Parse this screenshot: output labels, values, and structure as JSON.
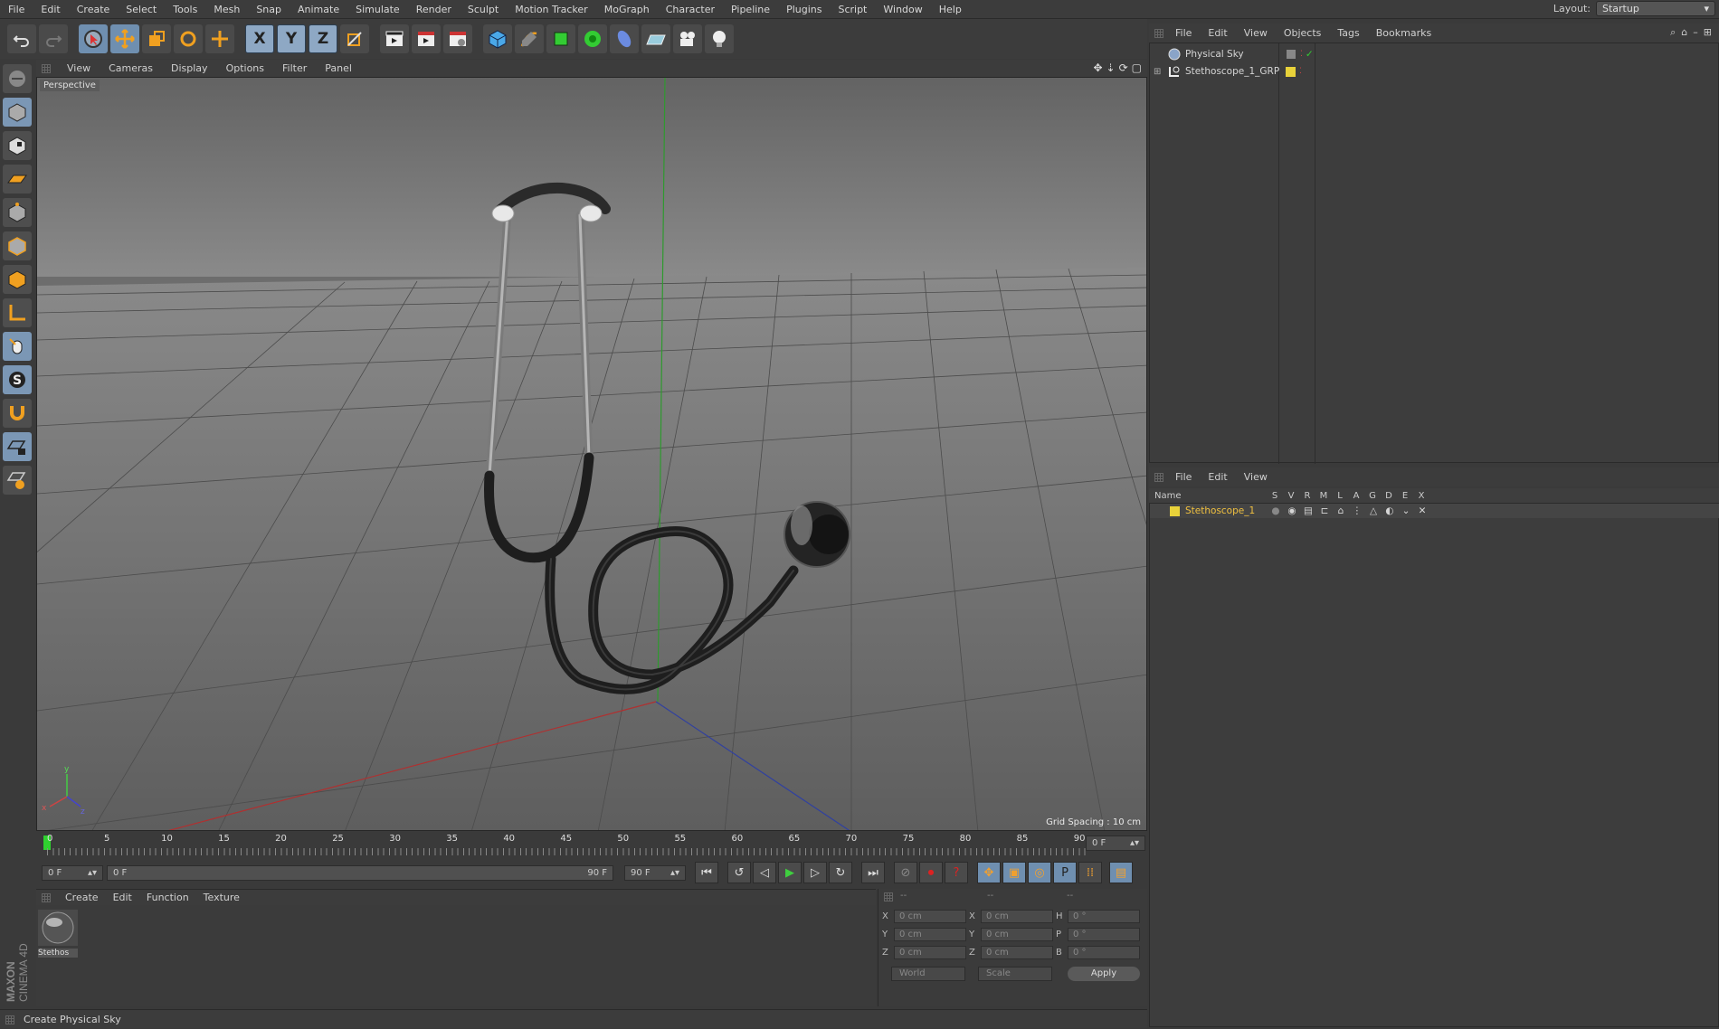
{
  "menubar": {
    "items": [
      "File",
      "Edit",
      "Create",
      "Select",
      "Tools",
      "Mesh",
      "Snap",
      "Animate",
      "Simulate",
      "Render",
      "Sculpt",
      "Motion Tracker",
      "MoGraph",
      "Character",
      "Pipeline",
      "Plugins",
      "Script",
      "Window",
      "Help"
    ],
    "layout_label": "Layout:",
    "layout_value": "Startup"
  },
  "toolbar": {
    "axis_x": "X",
    "axis_y": "Y",
    "axis_z": "Z"
  },
  "viewport": {
    "menu": [
      "View",
      "Cameras",
      "Display",
      "Options",
      "Filter",
      "Panel"
    ],
    "camera_label": "Perspective",
    "grid_spacing": "Grid Spacing : 10 cm"
  },
  "timeline": {
    "ticks": [
      "0",
      "5",
      "10",
      "15",
      "20",
      "25",
      "30",
      "35",
      "40",
      "45",
      "50",
      "55",
      "60",
      "65",
      "70",
      "75",
      "80",
      "85",
      "90"
    ],
    "end_field": "0 F",
    "current_frame": "0 F",
    "range_start": "0 F",
    "range_end": "90 F",
    "max_frame": "90 F"
  },
  "material_manager": {
    "menu": [
      "Create",
      "Edit",
      "Function",
      "Texture"
    ],
    "materials": [
      {
        "name": "Stethos"
      }
    ]
  },
  "coordinates": {
    "headers": [
      "--",
      "--",
      "--"
    ],
    "rows": [
      {
        "l1": "X",
        "v1": "0 cm",
        "l2": "X",
        "v2": "0 cm",
        "l3": "H",
        "v3": "0 °"
      },
      {
        "l1": "Y",
        "v1": "0 cm",
        "l2": "Y",
        "v2": "0 cm",
        "l3": "P",
        "v3": "0 °"
      },
      {
        "l1": "Z",
        "v1": "0 cm",
        "l2": "Z",
        "v2": "0 cm",
        "l3": "B",
        "v3": "0 °"
      }
    ],
    "space_dropdown": "World",
    "mode_dropdown": "Scale",
    "apply_label": "Apply"
  },
  "object_manager": {
    "menu": [
      "File",
      "Edit",
      "View",
      "Objects",
      "Tags",
      "Bookmarks"
    ],
    "objects": [
      {
        "name": "Physical Sky"
      },
      {
        "name": "Stethoscope_1_GRP"
      }
    ]
  },
  "attribute_manager": {
    "menu": [
      "File",
      "Edit",
      "View"
    ],
    "columns": [
      "Name",
      "S",
      "V",
      "R",
      "M",
      "L",
      "A",
      "G",
      "D",
      "E",
      "X"
    ],
    "rows": [
      {
        "name": "Stethoscope_1"
      }
    ]
  },
  "status": {
    "text": "Create Physical Sky"
  },
  "brand": {
    "line1": "MAXON",
    "line2": "CINEMA 4D"
  },
  "colors": {
    "accent_blue": "#7b97b5",
    "yellow_tag": "#e8d23a",
    "highlight_object": "#f0c040"
  }
}
